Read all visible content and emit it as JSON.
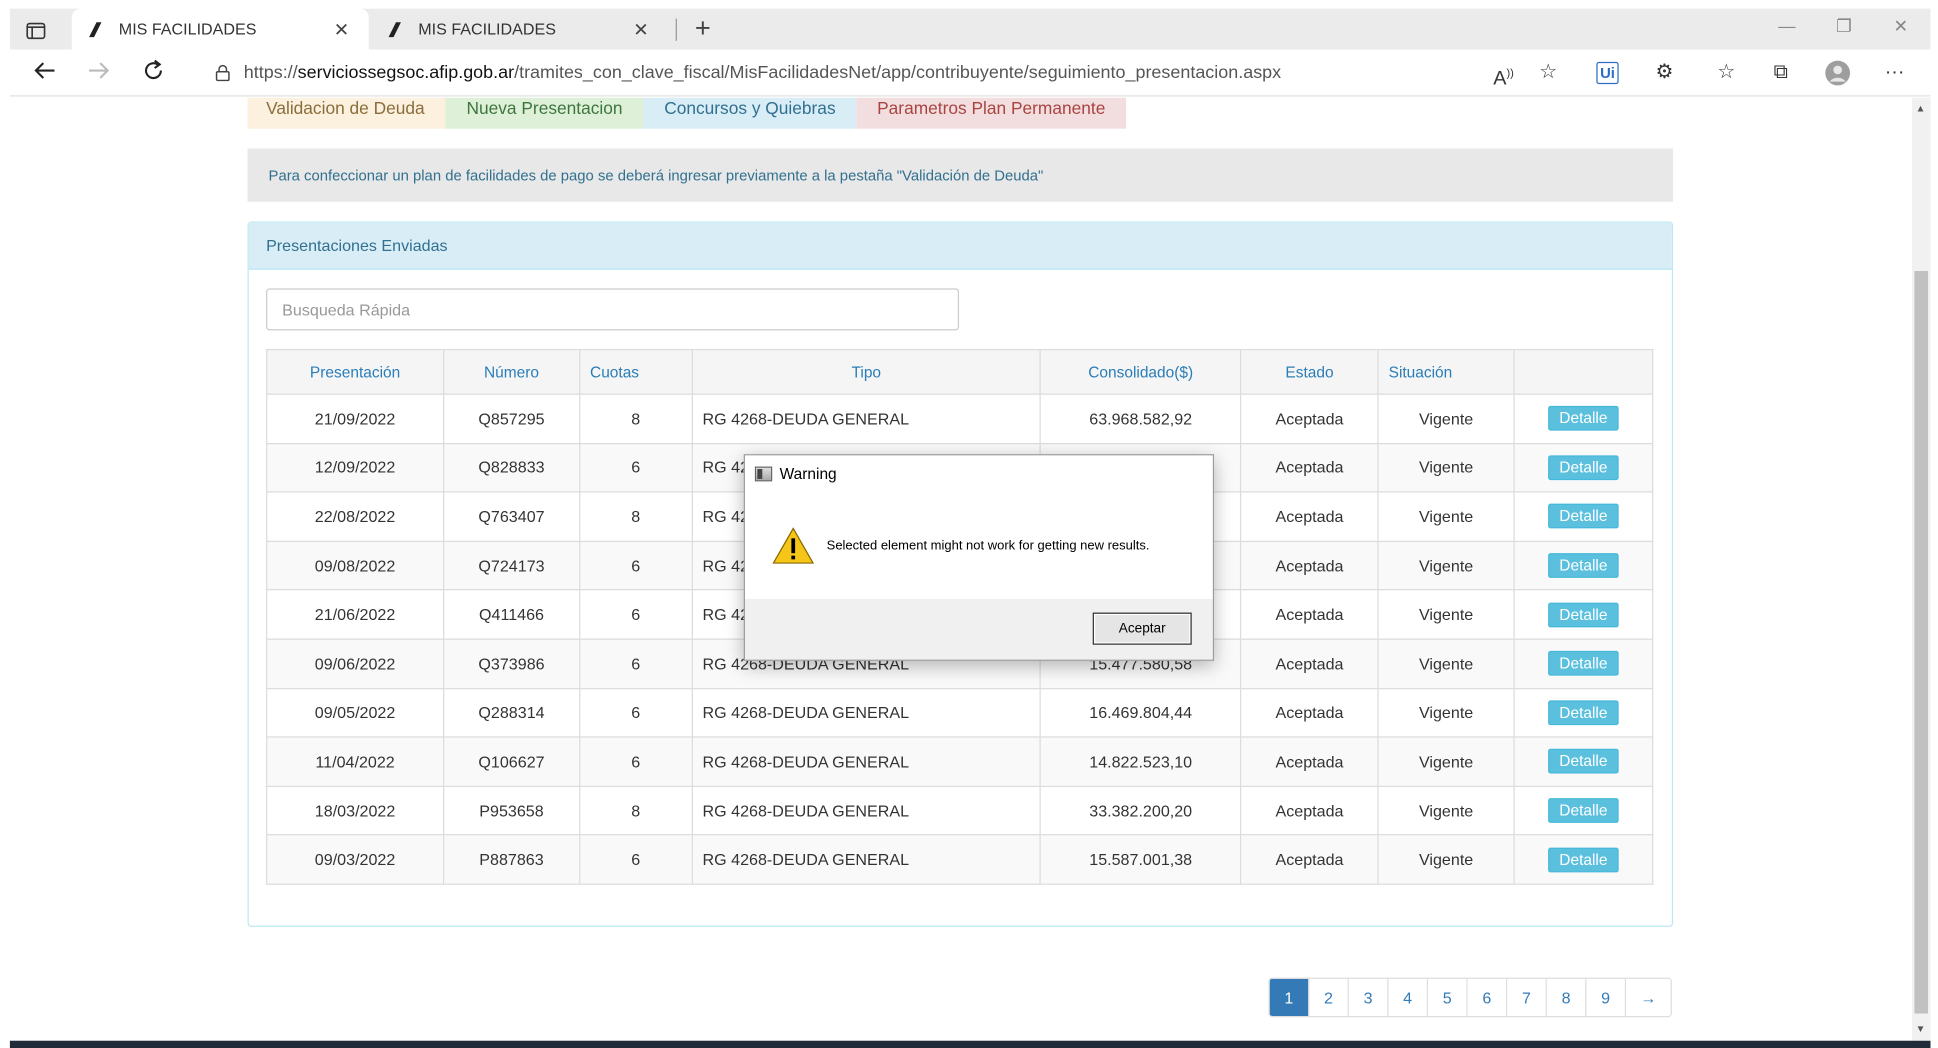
{
  "browser": {
    "tabs": [
      {
        "title": "MIS FACILIDADES",
        "active": true
      },
      {
        "title": "MIS FACILIDADES",
        "active": false
      }
    ],
    "url_prefix": "https://",
    "url_host": "serviciossegsoc.afip.gob.ar",
    "url_path": "/tramites_con_clave_fiscal/MisFacilidadesNet/app/contribuyente/seguimiento_presentacion.aspx"
  },
  "nav_tabs": [
    "Validacion de Deuda",
    "Nueva Presentacion",
    "Concursos y Quiebras",
    "Parametros Plan Permanente"
  ],
  "notice": "Para confeccionar un plan de facilidades de pago se deberá ingresar previamente a la pestaña \"Validación de Deuda\"",
  "panel": {
    "title": "Presentaciones Enviadas",
    "search_placeholder": "Busqueda Rápida"
  },
  "table": {
    "headers": [
      "Presentación",
      "Número",
      "Cuotas",
      "Tipo",
      "Consolidado($)",
      "Estado",
      "Situación",
      ""
    ],
    "rows": [
      [
        "21/09/2022",
        "Q857295",
        "8",
        "RG 4268-DEUDA GENERAL",
        "63.968.582,92",
        "Aceptada",
        "Vigente",
        "Detalle"
      ],
      [
        "12/09/2022",
        "Q828833",
        "6",
        "RG 42",
        "",
        "Aceptada",
        "Vigente",
        "Detalle"
      ],
      [
        "22/08/2022",
        "Q763407",
        "8",
        "RG 42",
        "",
        "Aceptada",
        "Vigente",
        "Detalle"
      ],
      [
        "09/08/2022",
        "Q724173",
        "6",
        "RG 42",
        "",
        "Aceptada",
        "Vigente",
        "Detalle"
      ],
      [
        "21/06/2022",
        "Q411466",
        "6",
        "RG 42",
        "",
        "Aceptada",
        "Vigente",
        "Detalle"
      ],
      [
        "09/06/2022",
        "Q373986",
        "6",
        "RG 4268-DEUDA GENERAL",
        "15.477.580,58",
        "Aceptada",
        "Vigente",
        "Detalle"
      ],
      [
        "09/05/2022",
        "Q288314",
        "6",
        "RG 4268-DEUDA GENERAL",
        "16.469.804,44",
        "Aceptada",
        "Vigente",
        "Detalle"
      ],
      [
        "11/04/2022",
        "Q106627",
        "6",
        "RG 4268-DEUDA GENERAL",
        "14.822.523,10",
        "Aceptada",
        "Vigente",
        "Detalle"
      ],
      [
        "18/03/2022",
        "P953658",
        "8",
        "RG 4268-DEUDA GENERAL",
        "33.382.200,20",
        "Aceptada",
        "Vigente",
        "Detalle"
      ],
      [
        "09/03/2022",
        "P887863",
        "6",
        "RG 4268-DEUDA GENERAL",
        "15.587.001,38",
        "Aceptada",
        "Vigente",
        "Detalle"
      ]
    ]
  },
  "pagination": {
    "pages": [
      "1",
      "2",
      "3",
      "4",
      "5",
      "6",
      "7",
      "8",
      "9"
    ],
    "active": "1",
    "next": "→"
  },
  "dialog": {
    "title": "Warning",
    "message": "Selected element might not work for getting new results.",
    "button": "Aceptar"
  },
  "colors": {
    "link": "#337ab7",
    "detalle_button": "#5bc0de",
    "panel_heading": "#d9edf7"
  }
}
